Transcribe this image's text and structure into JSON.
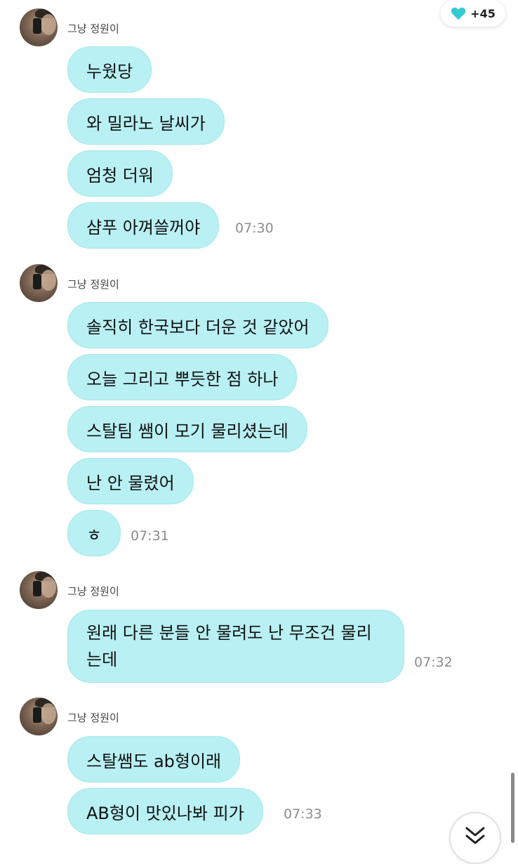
{
  "header": {
    "heart_count": "+45",
    "heart_color": "#35c9d4"
  },
  "colors": {
    "bubble": "#b8f0f3",
    "timestamp": "#8c8c8c"
  },
  "groups": [
    {
      "sender": "그냥 정원이",
      "messages": [
        "누웠당",
        "와 밀라노 날씨가",
        "엄청 더워",
        "샴푸 아껴쓸꺼야"
      ],
      "time": "07:30"
    },
    {
      "sender": "그냥 정원이",
      "messages": [
        "솔직히 한국보다 더운 것 같았어",
        "오늘 그리고 뿌듯한 점 하나",
        "스탈팀 쌤이 모기 물리셨는데",
        "난 안 물렸어",
        "ㅎ"
      ],
      "time": "07:31"
    },
    {
      "sender": "그냥 정원이",
      "messages": [
        [
          "원래 다른 분들 안 물려도 난 무조건 물리",
          "는데"
        ]
      ],
      "time": "07:32"
    },
    {
      "sender": "그냥 정원이",
      "messages": [
        "스탈쌤도 ab형이래",
        "AB형이 맛있나봐 피가"
      ],
      "time": "07:33"
    }
  ]
}
